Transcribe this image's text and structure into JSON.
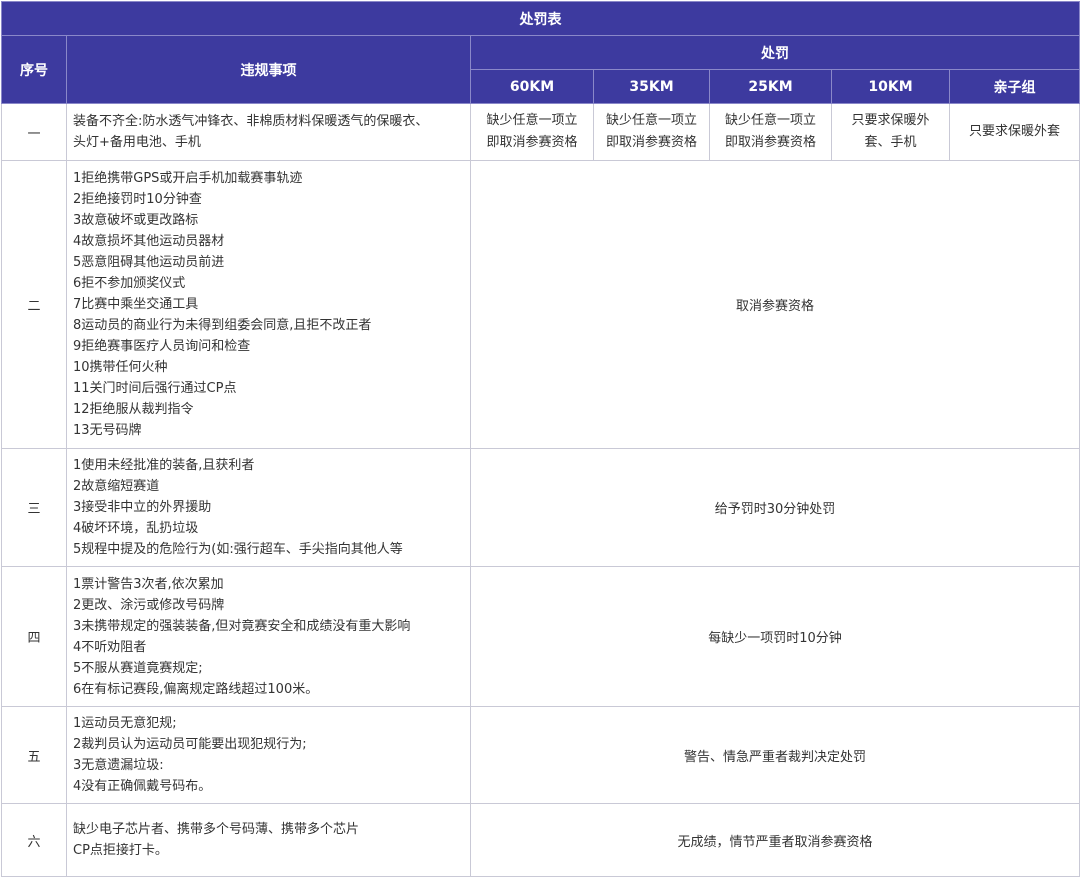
{
  "table": {
    "title": "处罚表",
    "headers": {
      "seq": "序号",
      "violation": "违规事项",
      "penalty": "处罚",
      "groups": [
        "60KM",
        "35KM",
        "25KM",
        "10KM",
        "亲子组"
      ]
    },
    "rows": [
      {
        "seq": "一",
        "items": [
          "装备不齐全:防水透气冲锋衣、非棉质材料保暖透气的保暖衣、",
          "头灯+备用电池、手机"
        ],
        "penalties": [
          [
            "缺少任意一项立",
            "即取消参赛资格"
          ],
          [
            "缺少任意一项立",
            "即取消参赛资格"
          ],
          [
            "缺少任意一项立",
            "即取消参赛资格"
          ],
          [
            "只要求保暖外",
            "套、手机"
          ],
          [
            "只要求保暖外套"
          ]
        ]
      },
      {
        "seq": "二",
        "items": [
          "1拒绝携带GPS或开启手机加载赛事轨迹",
          "2拒绝接罚时10分钟查",
          "3故意破坏或更改路标",
          "4故意损坏其他运动员器材",
          "5恶意阻碍其他运动员前进",
          "6拒不参加颁奖仪式",
          "7比赛中乘坐交通工具",
          "8运动员的商业行为未得到组委会同意,且拒不改正者",
          "9拒绝赛事医疗人员询问和检查",
          "10携带任何火种",
          "11关门时间后强行通过CP点",
          "12拒绝服从裁判指令",
          "13无号码牌"
        ],
        "penalty": "取消参赛资格"
      },
      {
        "seq": "三",
        "items": [
          "1使用未经批准的装备,且获利者",
          "2故意缩短赛道",
          "3接受非中立的外界援助",
          "4破坏环境，乱扔垃圾",
          "5规程中提及的危险行为(如:强行超车、手尖指向其他人等"
        ],
        "penalty": "给予罚时30分钟处罚"
      },
      {
        "seq": "四",
        "items": [
          "1票计警告3次者,依次累加",
          "2更改、涂污或修改号码牌",
          "3未携带规定的强装装备,但对竟赛安全和成绩没有重大影响",
          "4不听劝阻者",
          "5不服从赛道竟赛规定;",
          "6在有标记赛段,偏离规定路线超过100米。"
        ],
        "penalty": "每缺少一项罚时10分钟"
      },
      {
        "seq": "五",
        "items": [
          "1运动员无意犯规;",
          "2裁判员认为运动员可能要出现犯规行为;",
          "3无意遗漏垃圾:",
          "4没有正确佩戴号码布。"
        ],
        "penalty": "警告、情急严重者裁判决定处罚"
      },
      {
        "seq": "六",
        "items": [
          "缺少电子芯片者、携带多个号码薄、携带多个芯片",
          "CP点拒接打卡。"
        ],
        "penalty": "无成绩，情节严重者取消参赛资格"
      }
    ]
  },
  "colors": {
    "header_bg": "#3d3a9f",
    "header_text": "#ffffff",
    "border": "#c9c9d6",
    "body_text": "#333333"
  }
}
